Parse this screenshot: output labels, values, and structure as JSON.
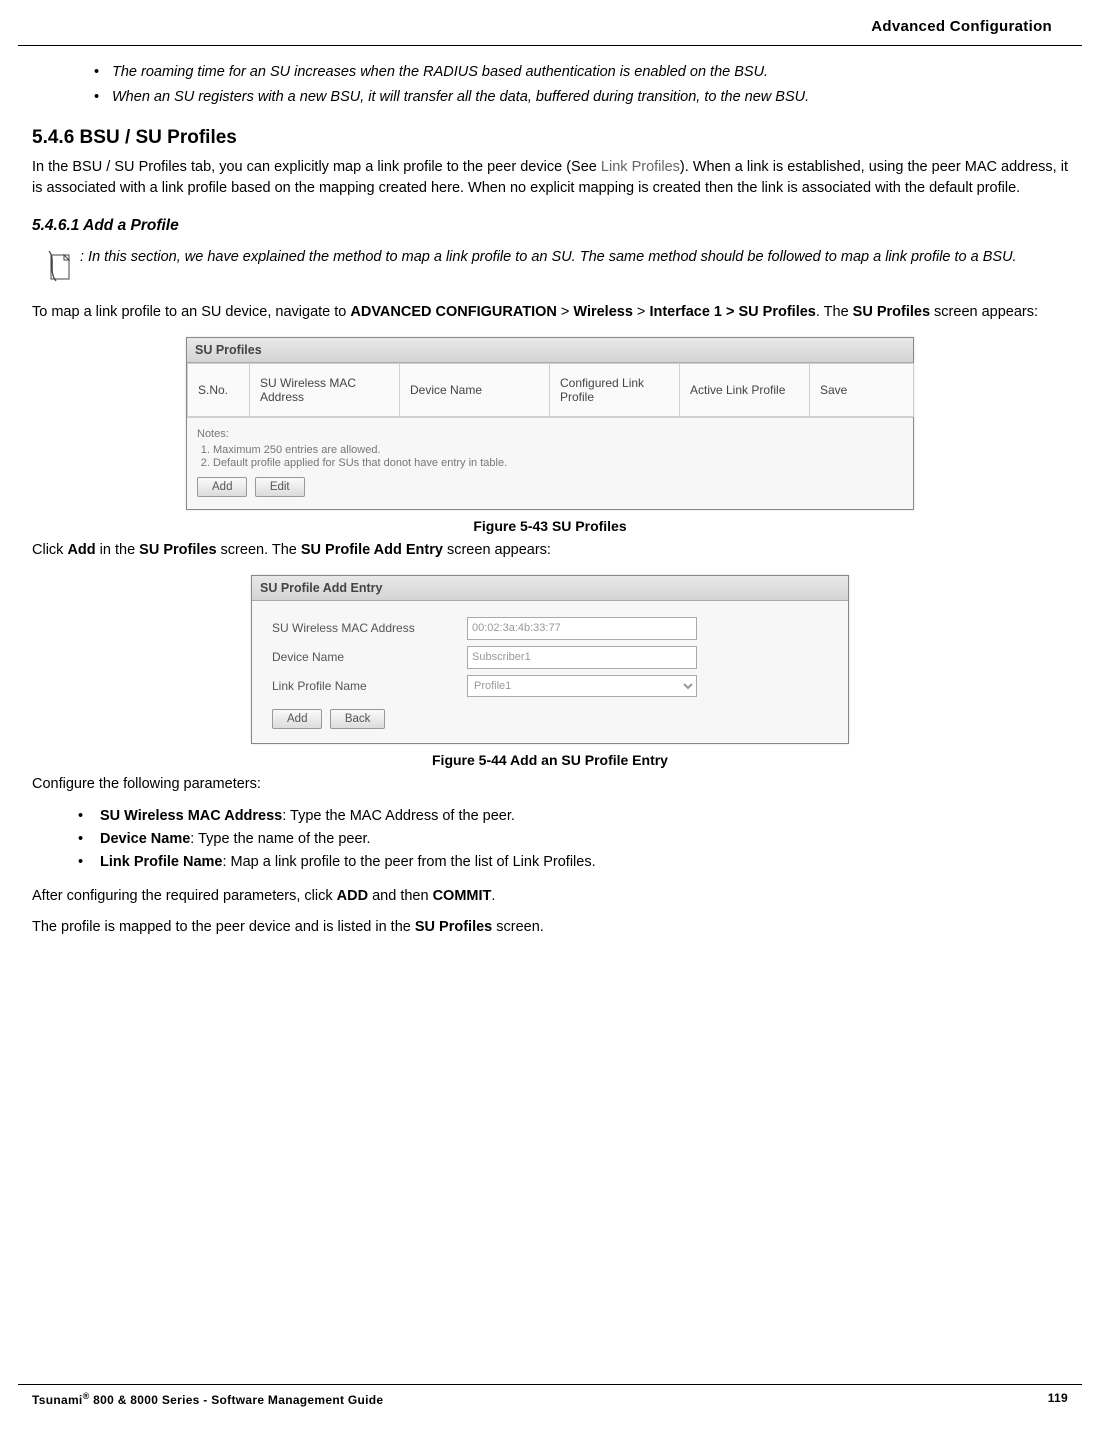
{
  "header": {
    "title": "Advanced Configuration"
  },
  "intro_bullets": [
    "The roaming time for an SU increases when the RADIUS based authentication is enabled on the BSU.",
    "When an SU registers with a new BSU, it will transfer all the data, buffered during transition, to the new BSU."
  ],
  "section": {
    "number": "5.4.6",
    "title": "BSU / SU Profiles",
    "body_prefix": "In the BSU / SU Profiles tab, you can explicitly map a link profile to the peer device (See ",
    "link_ref": "Link Profiles",
    "body_suffix": "). When a link is established, using the peer MAC address, it is associated with a link profile based on the mapping created here. When no explicit mapping is created then the link is associated with the default profile."
  },
  "subsection": {
    "number": "5.4.6.1",
    "title": "Add a Profile",
    "note": ": In this section, we have explained the method to map a link profile to an SU. The same method should be followed to map a link profile to a BSU.",
    "nav_text_prefix": "To map a link profile to an SU device, navigate to ",
    "nav_bold1": "ADVANCED CONFIGURATION",
    "nav_sep1": " > ",
    "nav_bold2": "Wireless",
    "nav_sep2": " > ",
    "nav_bold3": "Interface 1 > SU Profiles",
    "nav_suffix1": ". The ",
    "nav_bold4": "SU Profiles",
    "nav_suffix2": " screen appears:"
  },
  "figure1": {
    "panel_title": "SU Profiles",
    "columns": [
      "S.No.",
      "SU Wireless MAC Address",
      "Device Name",
      "Configured Link Profile",
      "Active Link Profile",
      "Save"
    ],
    "notes_label": "Notes:",
    "notes": [
      "Maximum 250 entries are allowed.",
      "Default profile applied for SUs that donot have entry in table."
    ],
    "buttons": {
      "add": "Add",
      "edit": "Edit"
    },
    "caption": "Figure 5-43 SU Profiles"
  },
  "click_text": {
    "p1": "Click ",
    "b1": "Add",
    "p2": " in the ",
    "b2": "SU Profiles",
    "p3": " screen. The ",
    "b3": "SU Profile Add Entry",
    "p4": " screen appears:"
  },
  "figure2": {
    "panel_title": "SU Profile Add Entry",
    "fields": {
      "mac_label": "SU Wireless MAC Address",
      "mac_value": "00:02:3a:4b:33:77",
      "device_label": "Device Name",
      "device_value": "Subscriber1",
      "profile_label": "Link Profile Name",
      "profile_value": "Profile1"
    },
    "buttons": {
      "add": "Add",
      "back": "Back"
    },
    "caption": "Figure 5-44 Add an SU Profile Entry"
  },
  "configure_text": "Configure the following parameters:",
  "params": [
    {
      "bold": "SU Wireless MAC Address",
      "rest": ": Type the MAC Address of the peer."
    },
    {
      "bold": "Device Name",
      "rest": ": Type the name of the peer."
    },
    {
      "bold": "Link Profile Name",
      "rest": ": Map a link profile to the peer from the list of Link Profiles."
    }
  ],
  "after_config": {
    "p1": "After configuring the required parameters, click ",
    "b1": "ADD",
    "p2": " and then ",
    "b2": "COMMIT",
    "p3": "."
  },
  "final_text": {
    "p1": "The profile is mapped to the peer device and is listed in the ",
    "b1": "SU Profiles",
    "p2": " screen."
  },
  "footer": {
    "product_prefix": "Tsunami",
    "product_suffix": " 800 & 8000 Series - Software Management Guide",
    "page": "119"
  }
}
